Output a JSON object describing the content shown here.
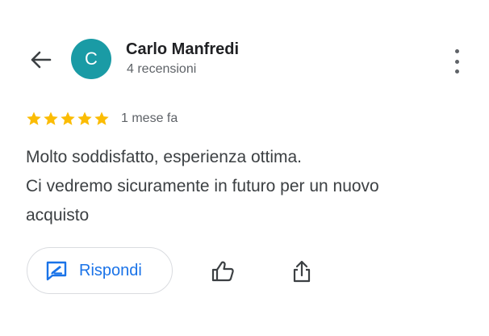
{
  "reviewer": {
    "avatar_initial": "C",
    "name": "Carlo Manfredi",
    "review_count": "4 recensioni"
  },
  "review": {
    "rating": 5,
    "max_rating": 5,
    "time_ago": "1 mese fa",
    "text_lines": [
      "Molto soddisfatto, esperienza ottima.",
      "Ci vedremo sicuramente in futuro per un nuovo",
      "acquisto"
    ]
  },
  "actions": {
    "reply_label": "Rispondi"
  },
  "icons": {
    "back": "arrow-back-icon",
    "more": "more-vert-icon",
    "star": "star-icon",
    "reply": "reply-edit-icon",
    "like": "thumb-up-icon",
    "share": "share-icon"
  },
  "colors": {
    "avatar_bg": "#1a9ba5",
    "star": "#fbbc04",
    "accent": "#1a73e8",
    "secondary_text": "#5f6368"
  }
}
